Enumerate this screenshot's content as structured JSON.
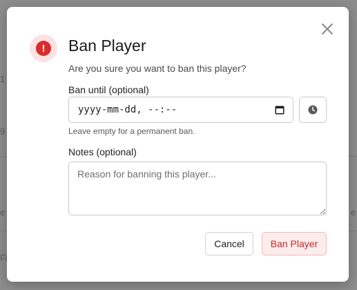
{
  "background": {
    "fragments": [
      "1",
      "9",
      "e",
      "e",
      "Filt"
    ]
  },
  "dialog": {
    "title": "Ban Player",
    "subtitle": "Are you sure you want to ban this player?",
    "warning_icon": "exclamation-icon",
    "close_icon": "close-icon",
    "ban_until": {
      "label": "Ban until (optional)",
      "value": "yyyy-mm-dd, --:--",
      "help": "Leave empty for a permanent ban."
    },
    "notes": {
      "label": "Notes (optional)",
      "placeholder": "Reason for banning this player..."
    },
    "buttons": {
      "cancel": "Cancel",
      "ban": "Ban Player"
    },
    "colors": {
      "danger": "#d92c2c",
      "danger_bg": "#fdecec",
      "danger_text": "#c62828"
    }
  }
}
